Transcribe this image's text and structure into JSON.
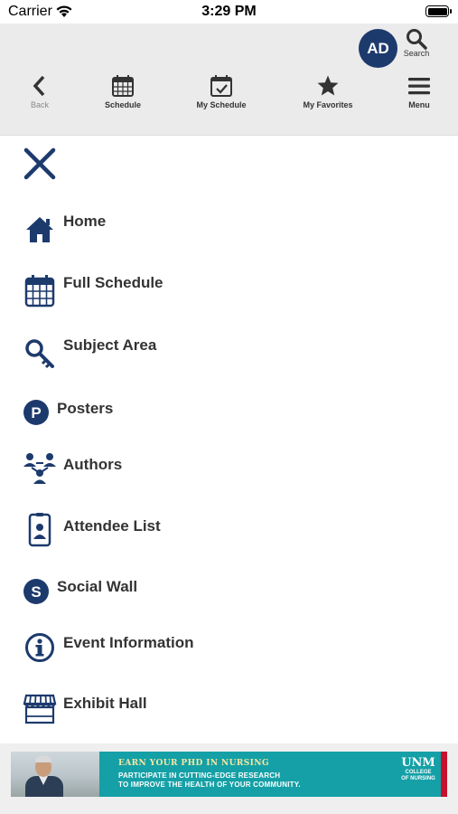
{
  "status_bar": {
    "carrier": "Carrier",
    "time": "3:29 PM"
  },
  "header": {
    "avatar_initials": "AD",
    "search_label": "Search",
    "nav": [
      {
        "label": "Back",
        "icon": "chevron-left-icon"
      },
      {
        "label": "Schedule",
        "icon": "calendar-icon"
      },
      {
        "label": "My Schedule",
        "icon": "calendar-check-icon"
      },
      {
        "label": "My Favorites",
        "icon": "star-icon"
      },
      {
        "label": "Menu",
        "icon": "hamburger-icon"
      }
    ]
  },
  "menu": {
    "close_icon": "close-icon",
    "items": [
      {
        "label": "Home",
        "icon": "home-icon"
      },
      {
        "label": "Full Schedule",
        "icon": "calendar-icon"
      },
      {
        "label": "Subject Area",
        "icon": "key-search-icon"
      },
      {
        "label": "Posters",
        "icon": "posters-p-icon"
      },
      {
        "label": "Authors",
        "icon": "people-network-icon"
      },
      {
        "label": "Attendee List",
        "icon": "id-badge-icon"
      },
      {
        "label": "Social Wall",
        "icon": "social-s-icon"
      },
      {
        "label": "Event Information",
        "icon": "info-icon"
      },
      {
        "label": "Exhibit Hall",
        "icon": "storefront-icon"
      }
    ]
  },
  "ad_banner": {
    "headline": "EARN YOUR PHD IN NURSING",
    "line2": "PARTICIPATE IN CUTTING-EDGE RESEARCH",
    "line3": "TO IMPROVE THE HEALTH OF YOUR COMMUNITY.",
    "logo_mark": "UNM",
    "logo_text_1": "COLLEGE",
    "logo_text_2": "OF NURSING"
  },
  "colors": {
    "accent": "#1d3a6d",
    "header_bg": "#ebebeb",
    "banner_teal": "#14a0a6",
    "banner_red": "#c8102e"
  }
}
